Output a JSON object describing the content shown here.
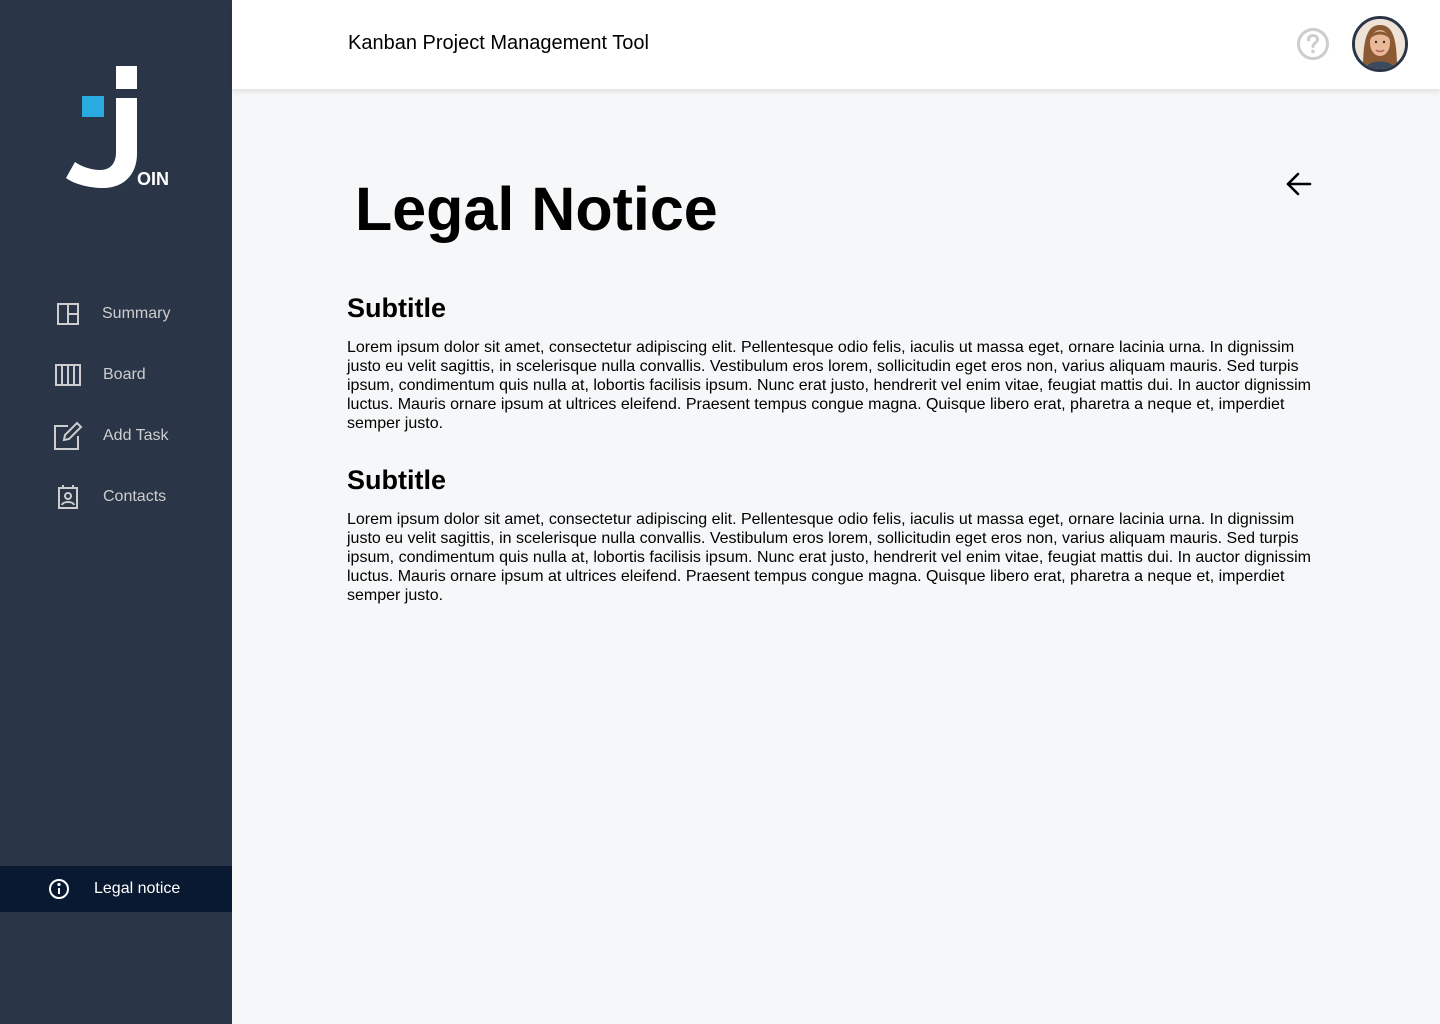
{
  "sidebar": {
    "logo_text": "OIN",
    "items": [
      {
        "label": "Summary",
        "icon": "summary-icon"
      },
      {
        "label": "Board",
        "icon": "board-icon"
      },
      {
        "label": "Add Task",
        "icon": "add-task-icon"
      },
      {
        "label": "Contacts",
        "icon": "contacts-icon"
      }
    ],
    "legal": {
      "label": "Legal notice",
      "icon": "info-icon"
    }
  },
  "header": {
    "title": "Kanban Project Management Tool",
    "help_icon": "help-icon",
    "avatar": "user-avatar"
  },
  "main": {
    "title": "Legal Notice",
    "back_icon": "arrow-left-icon",
    "sections": [
      {
        "subtitle": "Subtitle",
        "text": "Lorem ipsum dolor sit amet, consectetur adipiscing elit. Pellentesque odio felis, iaculis ut massa eget, ornare lacinia urna. In dignissim justo eu velit sagittis, in scelerisque nulla convallis. Vestibulum eros lorem, sollicitudin eget eros non, varius aliquam mauris. Sed turpis ipsum, condimentum quis nulla at, lobortis facilisis ipsum. Nunc erat justo, hendrerit vel enim vitae, feugiat mattis dui. In auctor dignissim luctus. Mauris ornare ipsum at ultrices eleifend. Praesent tempus congue magna. Quisque libero erat, pharetra a neque et, imperdiet semper justo."
      },
      {
        "subtitle": "Subtitle",
        "text": "Lorem ipsum dolor sit amet, consectetur adipiscing elit. Pellentesque odio felis, iaculis ut massa eget, ornare lacinia urna. In dignissim justo eu velit sagittis, in scelerisque nulla convallis. Vestibulum eros lorem, sollicitudin eget eros non, varius aliquam mauris. Sed turpis ipsum, condimentum quis nulla at, lobortis facilisis ipsum. Nunc erat justo, hendrerit vel enim vitae, feugiat mattis dui. In auctor dignissim luctus. Mauris ornare ipsum at ultrices eleifend. Praesent tempus congue magna. Quisque libero erat, pharetra a neque et, imperdiet semper justo."
      }
    ]
  },
  "colors": {
    "sidebar_bg": "#2A3647",
    "sidebar_active_bg": "#091931",
    "accent": "#29ABE2",
    "page_bg": "#F6F7F8"
  }
}
